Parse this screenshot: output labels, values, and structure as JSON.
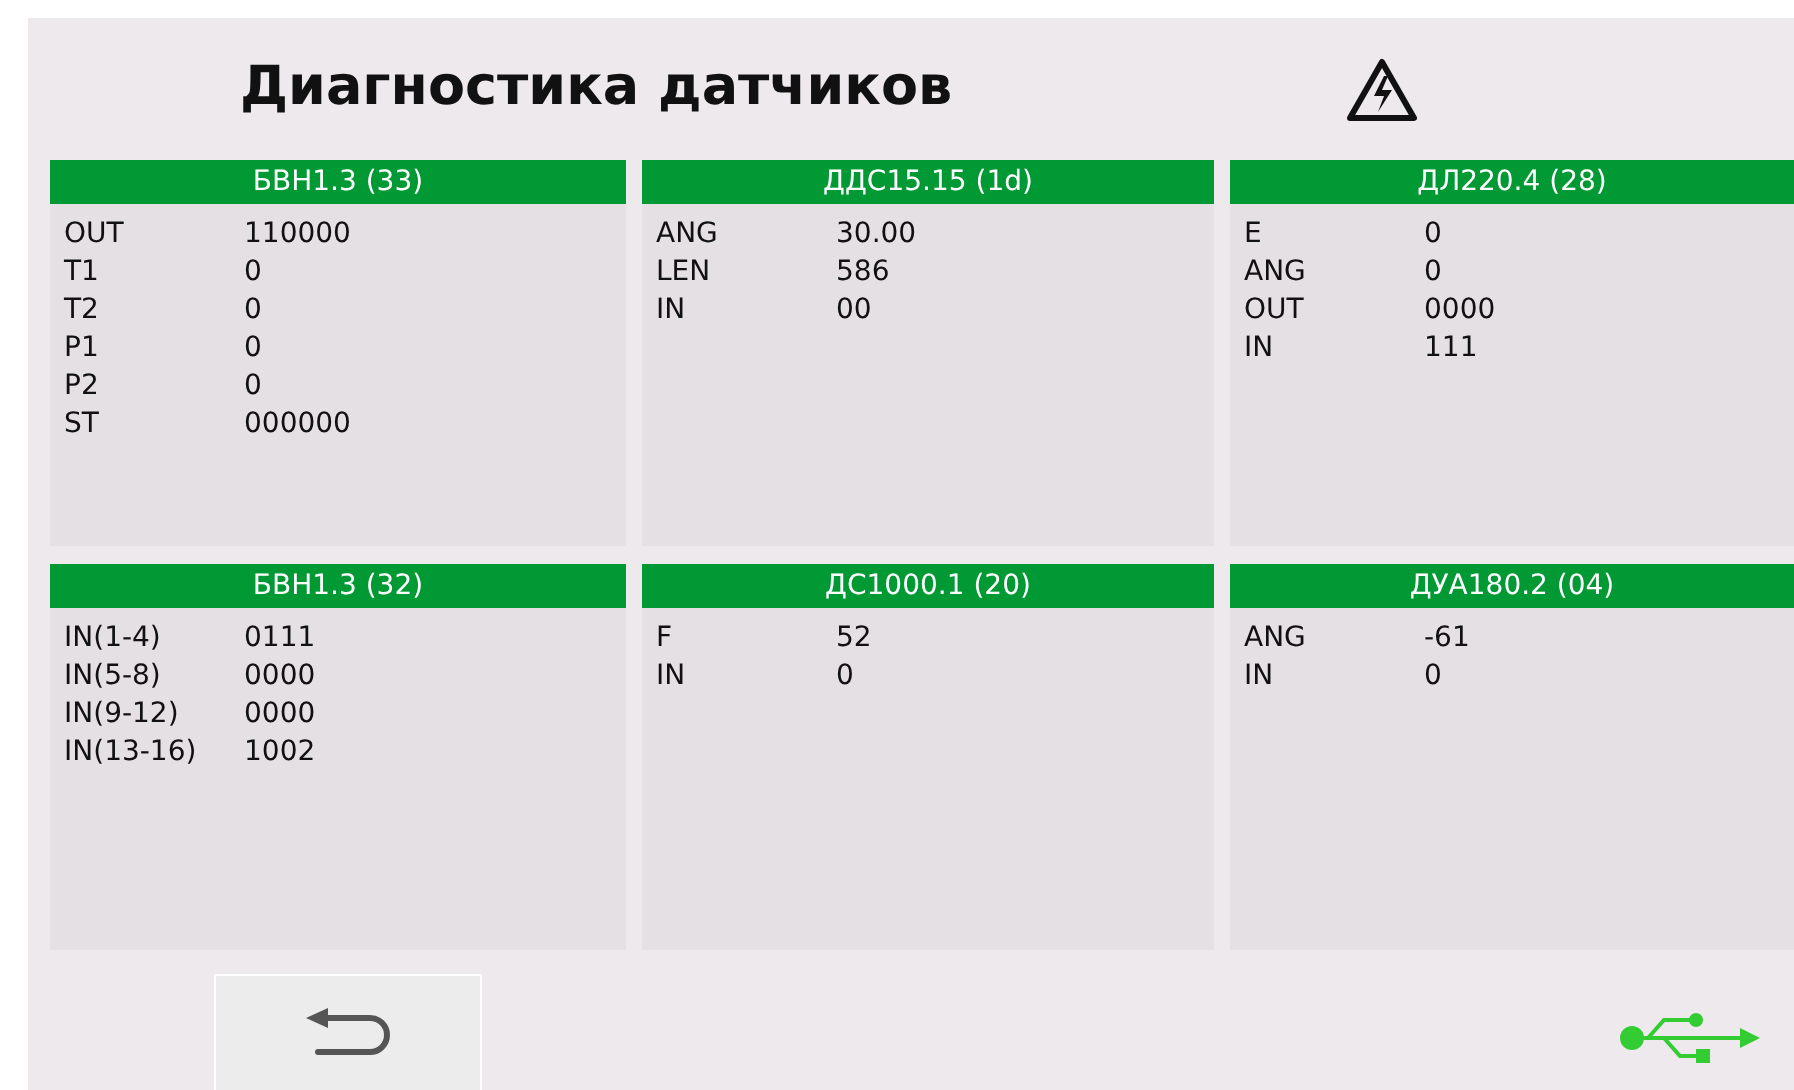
{
  "title": "Диагностика датчиков",
  "sensors": [
    {
      "name": "БВН1.3 (33)",
      "rows": [
        [
          "OUT",
          "110000"
        ],
        [
          "T1",
          "0"
        ],
        [
          "T2",
          "0"
        ],
        [
          "P1",
          "0"
        ],
        [
          "P2",
          "0"
        ],
        [
          "ST",
          "000000"
        ]
      ]
    },
    {
      "name": "ДДС15.15 (1d)",
      "rows": [
        [
          "ANG",
          "30.00"
        ],
        [
          "LEN",
          "586"
        ],
        [
          "IN",
          "00"
        ]
      ]
    },
    {
      "name": "ДЛ220.4 (28)",
      "rows": [
        [
          "E",
          "0"
        ],
        [
          "ANG",
          "0"
        ],
        [
          "OUT",
          "0000"
        ],
        [
          "IN",
          "111"
        ]
      ]
    },
    {
      "name": "БВН1.3 (32)",
      "rows": [
        [
          "IN(1-4)",
          "0111"
        ],
        [
          "IN(5-8)",
          "0000"
        ],
        [
          "IN(9-12)",
          "0000"
        ],
        [
          "IN(13-16)",
          "1002"
        ]
      ]
    },
    {
      "name": "ДС1000.1 (20)",
      "rows": [
        [
          "F",
          "52"
        ],
        [
          "IN",
          "0"
        ]
      ]
    },
    {
      "name": "ДУА180.2 (04)",
      "rows": [
        [
          "ANG",
          "-61"
        ],
        [
          "IN",
          "0"
        ]
      ]
    }
  ]
}
